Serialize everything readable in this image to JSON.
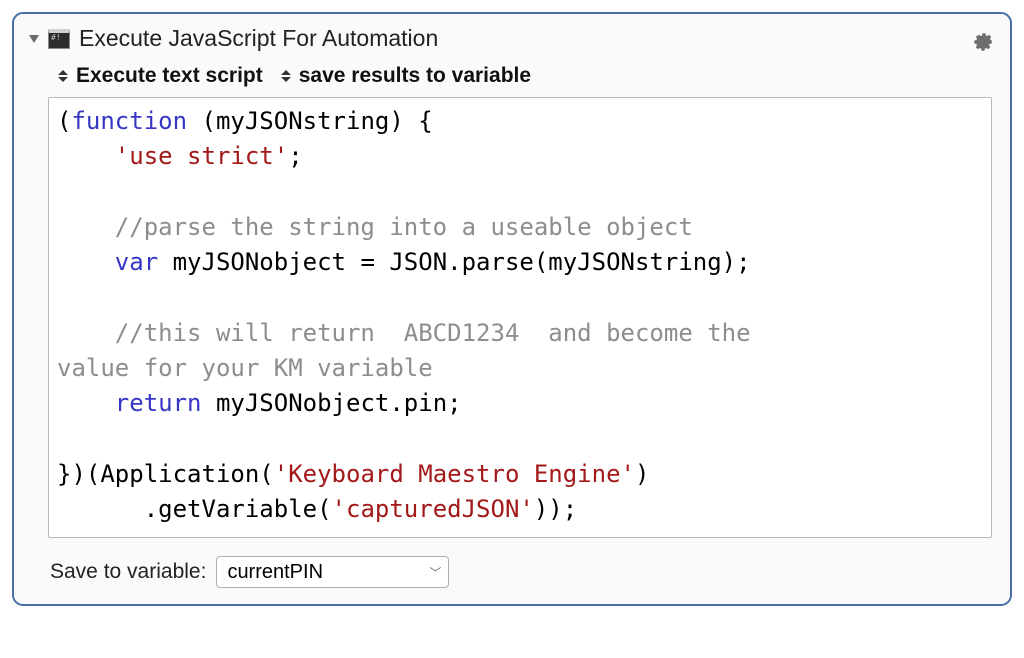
{
  "action": {
    "title": "Execute JavaScript For Automation",
    "option1": "Execute text script",
    "option2": "save results to variable"
  },
  "code": {
    "l1a": "(",
    "l1b": "function",
    "l1c": " (myJSONstring) {",
    "l2a": "    ",
    "l2b": "'use strict'",
    "l2c": ";",
    "l3": "",
    "l4a": "    ",
    "l4b": "//parse the string into a useable object",
    "l5a": "    ",
    "l5b": "var",
    "l5c": " myJSONobject = JSON.parse(myJSONstring);",
    "l6": "",
    "l7a": "    ",
    "l7b": "//this will return  ABCD1234  and become the ",
    "l8": "value for your KM variable",
    "l9a": "    ",
    "l9b": "return",
    "l9c": " myJSONobject.pin;",
    "l10": "",
    "l11a": "})(Application(",
    "l11b": "'Keyboard Maestro Engine'",
    "l11c": ")",
    "l12a": "      .getVariable(",
    "l12b": "'capturedJSON'",
    "l12c": "));"
  },
  "save": {
    "label": "Save to variable:",
    "value": "currentPIN"
  }
}
